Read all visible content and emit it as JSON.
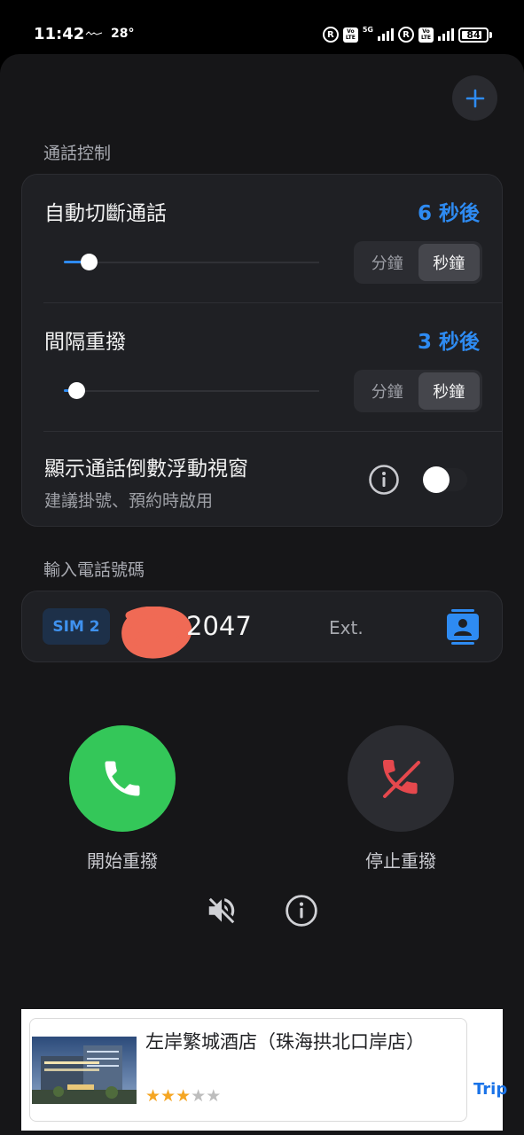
{
  "status_bar": {
    "time": "11:42",
    "temperature": "28°",
    "network": "5G",
    "battery_level": "84",
    "battery_fraction": 0.84,
    "icons": [
      "carrier-logo-icon",
      "roaming-r-icon",
      "volte-icon",
      "signal-icon",
      "battery-icon"
    ]
  },
  "header": {
    "add_button_icon": "plus-icon"
  },
  "call_control": {
    "section_label": "通話控制",
    "auto_hangup": {
      "title": "自動切斷通話",
      "value": "6 秒後",
      "slider_fraction": 0.1,
      "unit_options": [
        "分鐘",
        "秒鐘"
      ],
      "selected_unit": "秒鐘"
    },
    "redial_interval": {
      "title": "間隔重撥",
      "value": "3 秒後",
      "slider_fraction": 0.05,
      "unit_options": [
        "分鐘",
        "秒鐘"
      ],
      "selected_unit": "秒鐘"
    },
    "floating_window": {
      "title": "顯示通話倒數浮動視窗",
      "subtitle": "建議掛號、預約時啟用",
      "enabled": false
    }
  },
  "phone_input": {
    "section_label": "輸入電話號碼",
    "sim_label": "SIM 2",
    "number_visible": "2047",
    "ext_label": "Ext."
  },
  "actions": {
    "start_label": "開始重撥",
    "stop_label": "停止重撥"
  },
  "ad": {
    "title": "左岸繁城酒店（珠海拱北口岸店）",
    "rating": 3,
    "rating_max": 5,
    "brand": "Trip"
  },
  "colors": {
    "accent": "#2E8BF2",
    "start_green": "#34C759",
    "stop_red": "#E5484D",
    "background": "#161618",
    "card": "#1F2024"
  }
}
